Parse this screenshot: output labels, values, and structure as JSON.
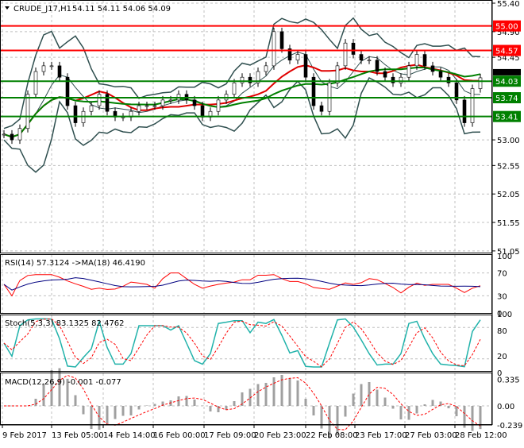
{
  "header": {
    "symbol_label": "CRUDE_J17,H1",
    "ohlc": "54.11 54.11 54.06 54.09"
  },
  "colors": {
    "resistance": "#ff0000",
    "support": "#008000",
    "ma_fast": "#e00000",
    "ma_slow": "#008000",
    "bands": "#2f4f4f",
    "rsi": "#ff0000",
    "rsi_ma": "#000080",
    "stoch_main": "#20b2aa",
    "stoch_signal": "#ff0000",
    "macd_hist": "#a0a0a0",
    "macd_signal": "#ff0000"
  },
  "chart_data": {
    "type": "candlestick",
    "ylim": [
      51.05,
      55.4
    ],
    "price_ticks": [
      "55.40",
      "54.90",
      "54.45",
      "53.00",
      "52.55",
      "52.05",
      "51.55",
      "51.05"
    ],
    "current_price": "54.09",
    "levels": [
      {
        "value": "55.00",
        "kind": "resistance"
      },
      {
        "value": "54.57",
        "kind": "resistance"
      },
      {
        "value": "54.03",
        "kind": "support"
      },
      {
        "value": "53.74",
        "kind": "support"
      },
      {
        "value": "53.41",
        "kind": "support"
      }
    ],
    "time_labels": [
      "9 Feb 2017",
      "13 Feb 05:00",
      "14 Feb 14:00",
      "16 Feb 00:00",
      "17 Feb 09:00",
      "20 Feb 23:00",
      "22 Feb 08:00",
      "23 Feb 17:00",
      "27 Feb 03:00",
      "28 Feb 12:00"
    ],
    "close": [
      53.1,
      53.0,
      53.2,
      53.8,
      54.2,
      54.3,
      54.3,
      54.1,
      53.6,
      53.3,
      53.5,
      53.6,
      53.8,
      53.5,
      53.4,
      53.4,
      53.5,
      53.6,
      53.6,
      53.6,
      53.7,
      53.7,
      53.8,
      53.7,
      53.6,
      53.4,
      53.5,
      53.7,
      53.8,
      54.0,
      54.1,
      54.0,
      54.2,
      54.3,
      54.9,
      54.6,
      54.4,
      54.5,
      54.1,
      53.6,
      53.5,
      54.0,
      54.3,
      54.7,
      54.5,
      54.4,
      54.4,
      54.2,
      54.1,
      54.0,
      54.1,
      54.3,
      54.5,
      54.3,
      54.2,
      54.1,
      54.0,
      53.7,
      53.3,
      53.9,
      54.09
    ]
  },
  "rsi": {
    "label": "RSI(14) 57.3124  ->MA(18) 46.4190",
    "ticks": [
      "100",
      "70",
      "30",
      "0"
    ]
  },
  "stoch": {
    "label": "Stoch(5,3,3) 83.1325 82.4762",
    "ticks": [
      "100",
      "80",
      "20",
      "0"
    ]
  },
  "macd": {
    "label": "MACD(12,26,9) -0.001 -0.077",
    "ticks": [
      "0.335",
      "0.00",
      "-0.239"
    ]
  }
}
